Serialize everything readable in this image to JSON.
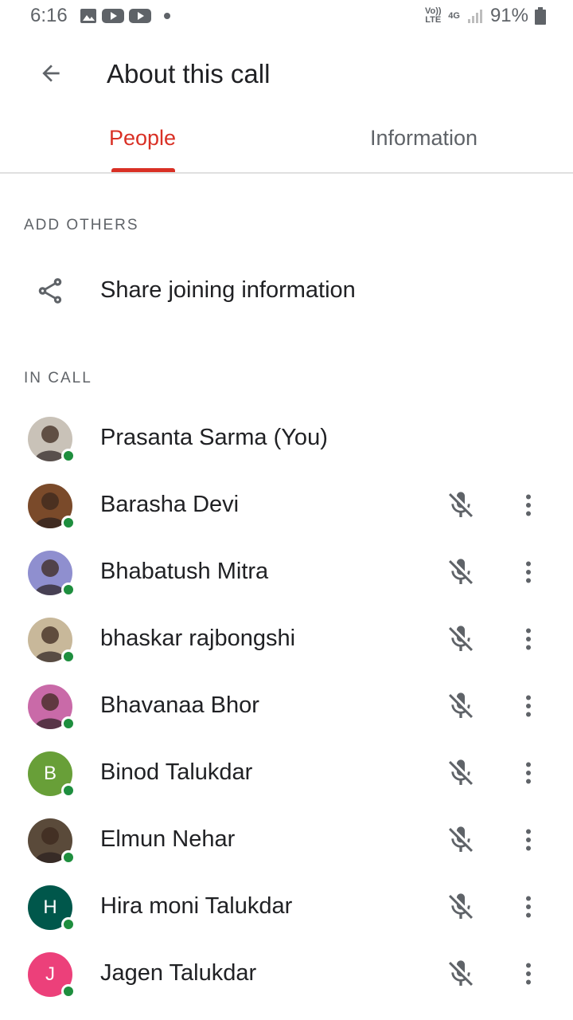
{
  "status_bar": {
    "time": "6:16",
    "network_top": "Vo)) LTE",
    "network_4g": "4G",
    "battery": "91%"
  },
  "app_bar": {
    "title": "About this call",
    "back_icon": "arrow-back-icon"
  },
  "tabs": [
    {
      "label": "People",
      "selected": true
    },
    {
      "label": "Information",
      "selected": false
    }
  ],
  "add_others": {
    "header": "ADD OTHERS",
    "share_label": "Share joining information",
    "share_icon": "share-icon"
  },
  "in_call": {
    "header": "IN CALL",
    "participants": [
      {
        "name": "Prasanta Sarma (You)",
        "avatar": "photo",
        "initial": "",
        "color": "#c9c2b8",
        "muted": false,
        "show_controls": false
      },
      {
        "name": "Barasha Devi",
        "avatar": "photo",
        "initial": "",
        "color": "#7a4a2a",
        "muted": true,
        "show_controls": true
      },
      {
        "name": "Bhabatush Mitra",
        "avatar": "photo",
        "initial": "",
        "color": "#8f8fcf",
        "muted": true,
        "show_controls": true
      },
      {
        "name": "bhaskar rajbongshi",
        "avatar": "photo",
        "initial": "",
        "color": "#c8b89a",
        "muted": true,
        "show_controls": true
      },
      {
        "name": "Bhavanaa Bhor",
        "avatar": "photo",
        "initial": "",
        "color": "#c96aa8",
        "muted": true,
        "show_controls": true
      },
      {
        "name": "Binod Talukdar",
        "avatar": "letter",
        "initial": "B",
        "color": "#689f38",
        "muted": true,
        "show_controls": true
      },
      {
        "name": "Elmun Nehar",
        "avatar": "photo",
        "initial": "",
        "color": "#5a4a3a",
        "muted": true,
        "show_controls": true
      },
      {
        "name": "Hira moni Talukdar",
        "avatar": "letter",
        "initial": "H",
        "color": "#00574b",
        "muted": true,
        "show_controls": true
      },
      {
        "name": "Jagen Talukdar",
        "avatar": "letter",
        "initial": "J",
        "color": "#ec407a",
        "muted": true,
        "show_controls": true
      }
    ]
  },
  "colors": {
    "accent": "#d93025",
    "online": "#1e8e3e",
    "secondary_text": "#5f6368"
  }
}
